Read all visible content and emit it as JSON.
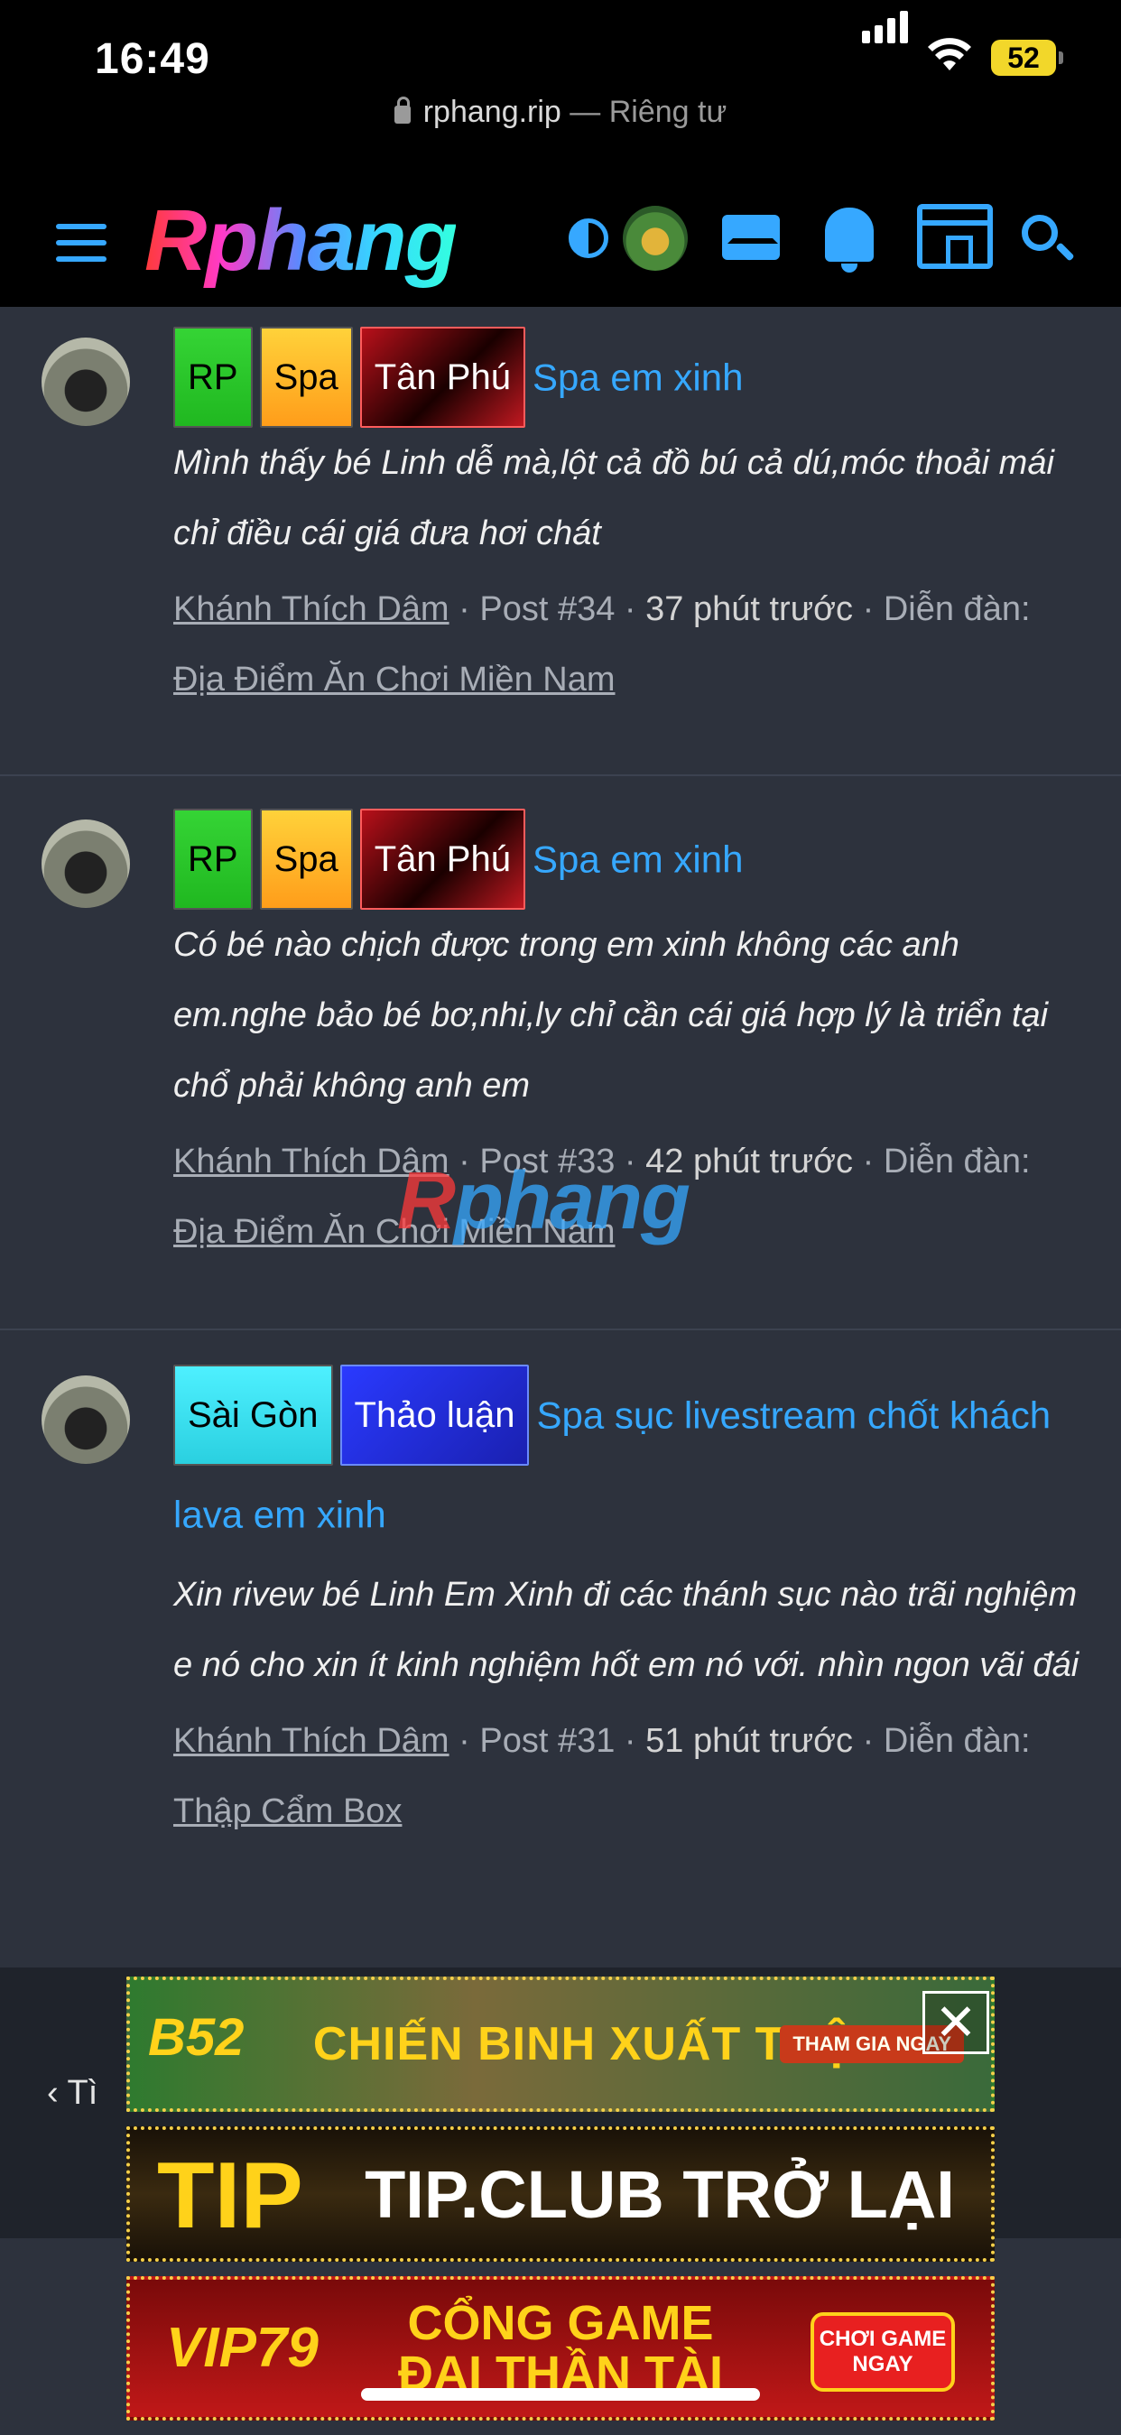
{
  "status_bar": {
    "time": "16:49",
    "battery": "52"
  },
  "url_bar": {
    "domain": "rphang.rip",
    "separator": " — ",
    "mode": "Riêng tư"
  },
  "header": {
    "logo": "Rphang"
  },
  "posts": [
    {
      "tags": [
        "RP",
        "Spa",
        "Tân Phú"
      ],
      "title": "Spa em xinh",
      "snippet": "Mình thấy bé Linh dễ mà,lột cả đồ bú cả dú,móc thoải mái chỉ điều cái giá đưa hơi chát",
      "author": "Khánh Thích Dâm",
      "post_no": "Post #34",
      "time": "37 phút trước",
      "forum_label": "Diễn đàn:",
      "forum": "Địa Điểm Ăn Chơi Miền Nam"
    },
    {
      "tags": [
        "RP",
        "Spa",
        "Tân Phú"
      ],
      "title": "Spa em xinh",
      "snippet": "Có bé nào chịch được trong em xinh không các anh em.nghe bảo bé bơ,nhi,ly chỉ cần cái giá hợp lý là triển tại chổ phải không anh em",
      "author": "Khánh Thích Dâm",
      "post_no": "Post #33",
      "time": "42 phút trước",
      "forum_label": "Diễn đàn:",
      "forum": "Địa Điểm Ăn Chơi Miền Nam"
    },
    {
      "tags": [
        "Sài Gòn",
        "Thảo luận"
      ],
      "title": "Spa sục livestream chốt khách lava em xinh",
      "snippet": "Xin rivew bé Linh Em Xinh đi các thánh sục nào trãi nghiệm e nó cho xin ít kinh nghiệm hốt em nó với. nhìn ngon vãi đái",
      "author": "Khánh Thích Dâm",
      "post_no": "Post #31",
      "time": "51 phút trước",
      "forum_label": "Diễn đàn:",
      "forum": "Thập Cẩm Box"
    }
  ],
  "watermark": {
    "a": "R",
    "b": "phang"
  },
  "footer": {
    "back_label": "Tì"
  },
  "ads": {
    "ad1": {
      "badge": "B52",
      "text": "CHIẾN BINH XUẤT TRẬN",
      "cta": "THAM GIA NGAY"
    },
    "ad2": {
      "badge": "TIP",
      "text": "TIP.CLUB TRỞ LẠI"
    },
    "ad3": {
      "badge": "VIP79",
      "line1": "CỔNG GAME",
      "line2": "ĐẠI THẦN TÀI",
      "cta1": "CHƠI GAME",
      "cta2": "NGAY"
    },
    "close": "✕"
  },
  "colors": {
    "accent": "#36a8ff",
    "background": "#2d323d",
    "header_bg": "#000000"
  }
}
